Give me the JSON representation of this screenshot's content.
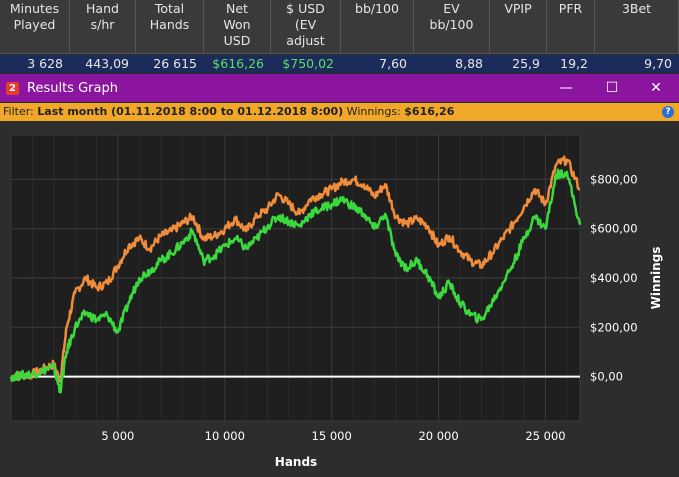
{
  "stats": {
    "headers": [
      "Minutes\nPlayed",
      "Hand\ns/hr",
      "Total\nHands",
      "Net\nWon\nUSD",
      "$ USD\n(EV\nadjust",
      "bb/100",
      "EV\nbb/100",
      "VPIP",
      "PFR",
      "3Bet"
    ],
    "values": [
      "3 628",
      "443,09",
      "26 615",
      "$616,26",
      "$750,02",
      "7,60",
      "8,88",
      "25,9",
      "19,2",
      "9,70"
    ],
    "positive_color": "#5cdc6a"
  },
  "window": {
    "icon_label": "2",
    "title": "Results Graph",
    "minimize_glyph": "—",
    "maximize_glyph": "☐",
    "close_glyph": "✕",
    "title_bar_color": "#8b159e"
  },
  "filter": {
    "label": "Filter: ",
    "range": "Last month (01.11.2018 8:00 to 01.12.2018 8:00)",
    "winnings_label": " Winnings: ",
    "winnings_value": "$616,26",
    "help_glyph": "?"
  },
  "chart_data": {
    "type": "line",
    "xlabel": "Hands",
    "ylabel": "Winnings",
    "xlim": [
      0,
      26615
    ],
    "ylim": [
      -180,
      980
    ],
    "x_ticks": [
      5000,
      10000,
      15000,
      20000,
      25000
    ],
    "x_tick_labels": [
      "5 000",
      "10 000",
      "15 000",
      "20 000",
      "25 000"
    ],
    "y_ticks": [
      0,
      200,
      400,
      600,
      800
    ],
    "y_tick_labels": [
      "$0,00",
      "$200,00",
      "$400,00",
      "$600,00",
      "$800,00"
    ],
    "grid": true,
    "series": [
      {
        "color": "#f08c3a",
        "x": [
          0,
          500,
          1000,
          1500,
          2000,
          2300,
          2600,
          3000,
          3500,
          4000,
          4500,
          5000,
          5500,
          6000,
          6500,
          7000,
          7500,
          8000,
          8500,
          9000,
          9500,
          10000,
          10500,
          11000,
          11500,
          12000,
          12500,
          13000,
          13500,
          14000,
          14500,
          15000,
          15500,
          16000,
          16500,
          17000,
          17500,
          18000,
          18500,
          19000,
          19500,
          20000,
          20500,
          21000,
          21500,
          22000,
          22500,
          23000,
          23500,
          24000,
          24500,
          25000,
          25500,
          26000,
          26615
        ],
        "values": [
          0,
          5,
          10,
          30,
          50,
          -20,
          200,
          340,
          400,
          360,
          380,
          450,
          530,
          560,
          520,
          570,
          590,
          620,
          650,
          560,
          570,
          600,
          640,
          590,
          650,
          680,
          740,
          700,
          660,
          720,
          740,
          760,
          790,
          800,
          780,
          730,
          780,
          650,
          620,
          640,
          610,
          530,
          570,
          510,
          470,
          450,
          500,
          560,
          620,
          690,
          760,
          700,
          860,
          880,
          760
        ]
      },
      {
        "color": "#3ad93e",
        "x": [
          0,
          500,
          1000,
          1500,
          2000,
          2300,
          2600,
          3000,
          3500,
          4000,
          4500,
          5000,
          5500,
          6000,
          6500,
          7000,
          7500,
          8000,
          8500,
          9000,
          9500,
          10000,
          10500,
          11000,
          11500,
          12000,
          12500,
          13000,
          13500,
          14000,
          14500,
          15000,
          15500,
          16000,
          16500,
          17000,
          17500,
          18000,
          18500,
          19000,
          19500,
          20000,
          20500,
          21000,
          21500,
          22000,
          22500,
          23000,
          23500,
          24000,
          24500,
          25000,
          25500,
          26000,
          26615
        ],
        "values": [
          0,
          5,
          10,
          25,
          40,
          -60,
          100,
          200,
          260,
          230,
          250,
          180,
          300,
          400,
          430,
          470,
          500,
          540,
          590,
          470,
          490,
          530,
          560,
          520,
          560,
          610,
          650,
          630,
          610,
          660,
          680,
          700,
          720,
          690,
          660,
          600,
          660,
          490,
          440,
          470,
          410,
          320,
          380,
          300,
          250,
          230,
          300,
          380,
          460,
          560,
          650,
          600,
          820,
          830,
          616
        ]
      }
    ]
  }
}
